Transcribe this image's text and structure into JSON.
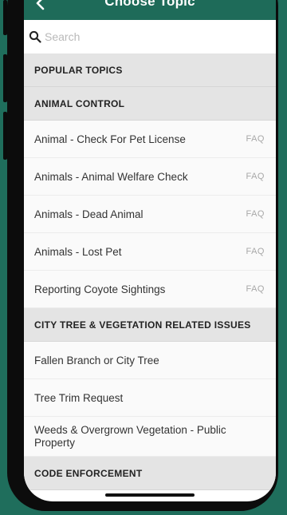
{
  "header": {
    "title": "Choose Topic"
  },
  "search": {
    "placeholder": "Search",
    "value": ""
  },
  "sections": [
    {
      "label": "POPULAR TOPICS"
    },
    {
      "label": "ANIMAL CONTROL"
    },
    {
      "label": "CITY TREE & VEGETATION RELATED ISSUES"
    },
    {
      "label": "CODE ENFORCEMENT"
    }
  ],
  "animal_items": [
    {
      "label": "Animal - Check For Pet License",
      "badge": "FAQ"
    },
    {
      "label": "Animals - Animal Welfare Check",
      "badge": "FAQ"
    },
    {
      "label": "Animals - Dead Animal",
      "badge": "FAQ"
    },
    {
      "label": "Animals - Lost Pet",
      "badge": "FAQ"
    },
    {
      "label": "Reporting Coyote Sightings",
      "badge": "FAQ"
    }
  ],
  "tree_items": [
    {
      "label": "Fallen Branch or City Tree"
    },
    {
      "label": "Tree Trim Request"
    },
    {
      "label": "Weeds & Overgrown Vegetation - Public Property"
    }
  ],
  "colors": {
    "brand": "#1e6b59",
    "section_bg": "#e4e4e4",
    "faq": "#a8a8a8"
  },
  "icons": {
    "back": "chevron-left-icon",
    "search": "magnifier-icon"
  }
}
